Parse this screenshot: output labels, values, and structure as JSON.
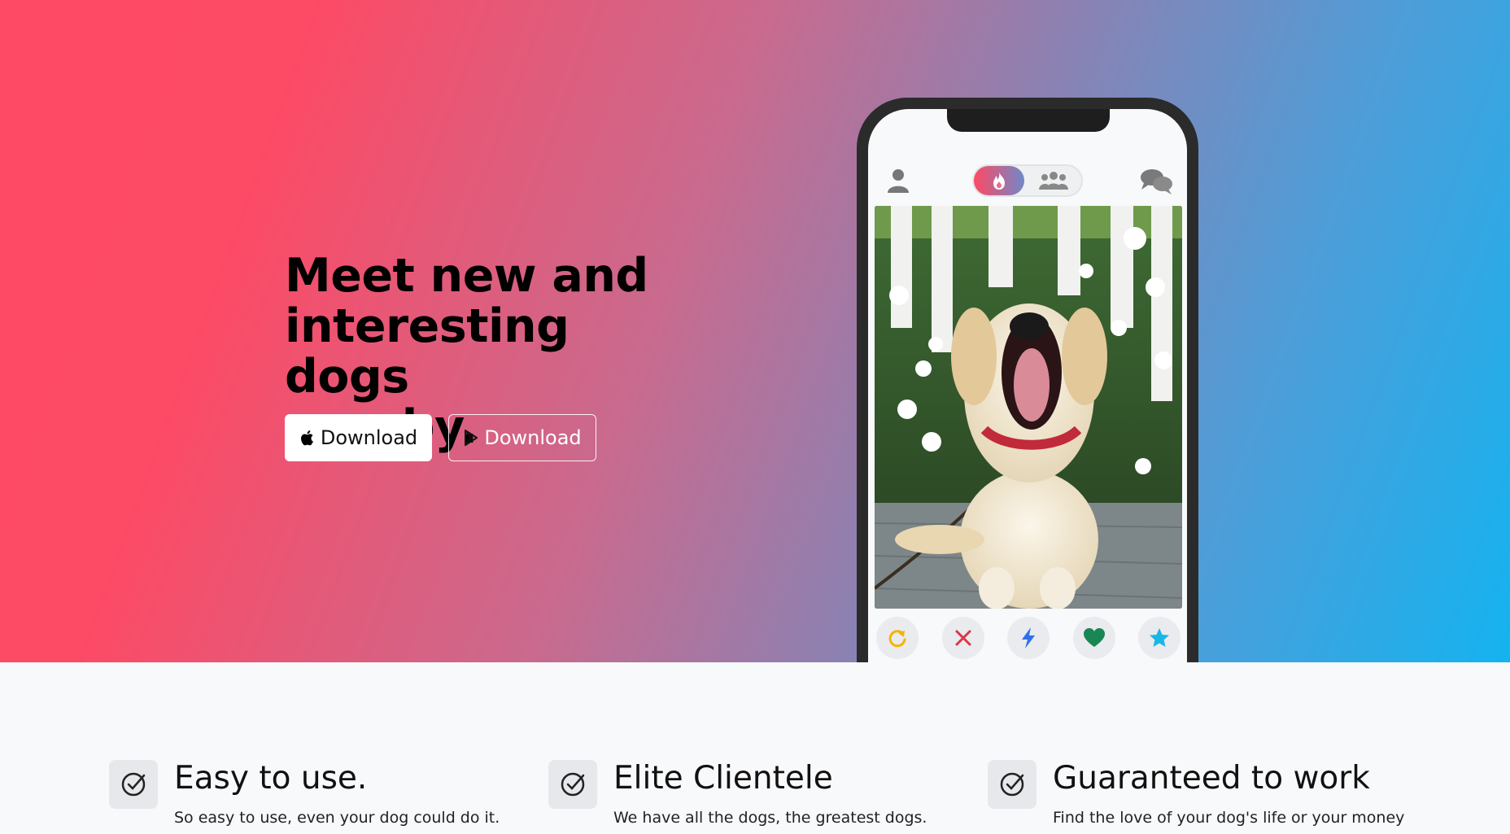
{
  "hero": {
    "headline_line1": "Meet new and",
    "headline_line2": "interesting dogs",
    "headline_line3": "nearby.",
    "ios_button_label": "Download",
    "android_button_label": "Download",
    "gradient_colors": [
      "#fe4a64",
      "#14b3f0"
    ]
  },
  "phone": {
    "tab_active_icon": "flame-icon",
    "tab_inactive_icon": "people-group-icon",
    "left_icon": "person-icon",
    "right_icon": "chat-bubbles-icon",
    "photo_subject": "dog-photo",
    "actions": [
      {
        "name": "rewind",
        "icon": "rotate-arrow-icon",
        "color": "#f4b400"
      },
      {
        "name": "nope",
        "icon": "x-icon",
        "color": "#dc3545"
      },
      {
        "name": "boost",
        "icon": "lightning-icon",
        "color": "#2f6fed"
      },
      {
        "name": "like",
        "icon": "heart-icon",
        "color": "#198754"
      },
      {
        "name": "super-like",
        "icon": "star-icon",
        "color": "#17b7e6"
      }
    ]
  },
  "features": [
    {
      "title": "Easy to use.",
      "description": "So easy to use, even your dog could do it."
    },
    {
      "title": "Elite Clientele",
      "description": "We have all the dogs, the greatest dogs."
    },
    {
      "title": "Guaranteed to work",
      "description": "Find the love of your dog's life or your money"
    }
  ]
}
